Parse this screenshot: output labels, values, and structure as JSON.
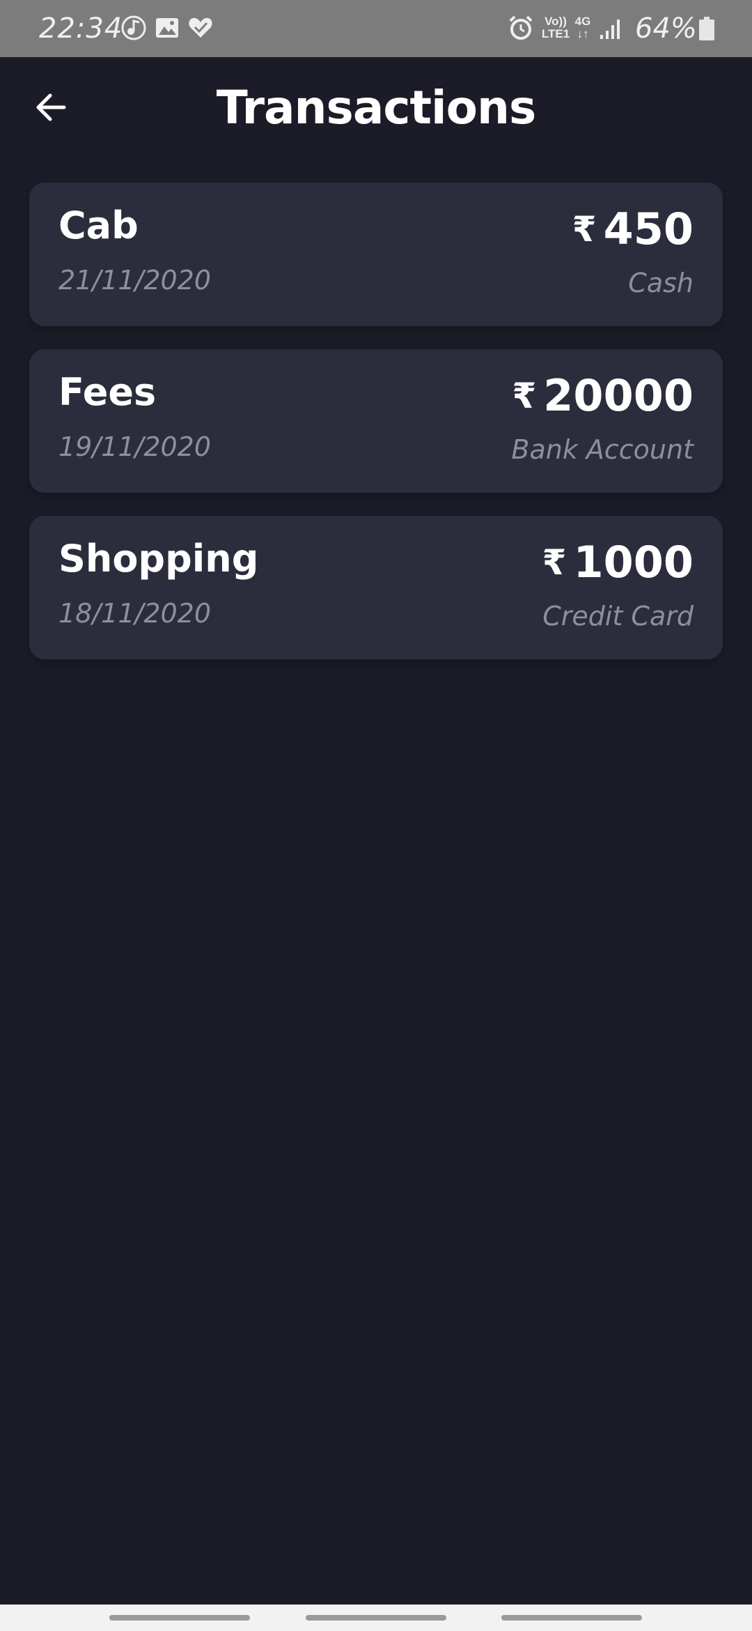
{
  "status_bar": {
    "time": "22:34",
    "icons": [
      "music-note-icon",
      "image-icon",
      "heart-check-icon",
      "alarm-icon",
      "signal-icon",
      "battery-icon"
    ],
    "volte_line1": "Vo))",
    "volte_line2": "LTE1",
    "network_line1": "4G",
    "network_line2": "↓↑",
    "battery": "64%"
  },
  "header": {
    "back_icon": "arrow-left-icon",
    "title": "Transactions"
  },
  "currency_symbol": "₹",
  "transactions": [
    {
      "name": "Cab",
      "date": "21/11/2020",
      "amount": "450",
      "method": "Cash"
    },
    {
      "name": "Fees",
      "date": "19/11/2020",
      "amount": "20000",
      "method": "Bank Account"
    },
    {
      "name": "Shopping",
      "date": "18/11/2020",
      "amount": "1000",
      "method": "Credit Card"
    }
  ],
  "colors": {
    "background": "#1b1c27",
    "card": "#2b2d3c",
    "text_primary": "#ffffff",
    "text_secondary": "#8d8f9c",
    "status_bar": "#7c7c7c"
  }
}
